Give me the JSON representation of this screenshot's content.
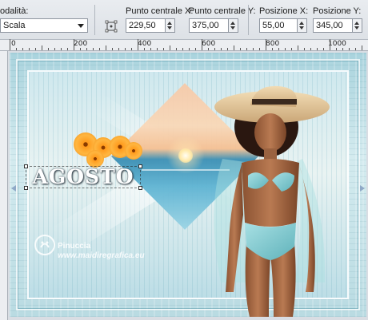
{
  "toolbar": {
    "mode_label": "odalità:",
    "mode_value": "Scala",
    "center_x_label": "Punto centrale X:",
    "center_x_value": "229,50",
    "center_y_label": "Punto centrale Y:",
    "center_y_value": "375,00",
    "pos_x_label": "Posizione X:",
    "pos_x_value": "55,00",
    "pos_y_label": "Posizione Y:",
    "pos_y_value": "345,00"
  },
  "ruler": {
    "labels": [
      "0",
      "200",
      "400",
      "600",
      "800",
      "1000"
    ]
  },
  "canvas": {
    "title_text": "AGOSTO",
    "watermark_name": "Pinuccia",
    "watermark_url": "www.maidiregrafica.eu"
  },
  "colors": {
    "frame": "#a9d3dd",
    "sunset_sky": "#f6c9a8",
    "sea": "#3b8fb4",
    "flowers": "#ffb640",
    "swimsuit": "#7fc9cf"
  }
}
